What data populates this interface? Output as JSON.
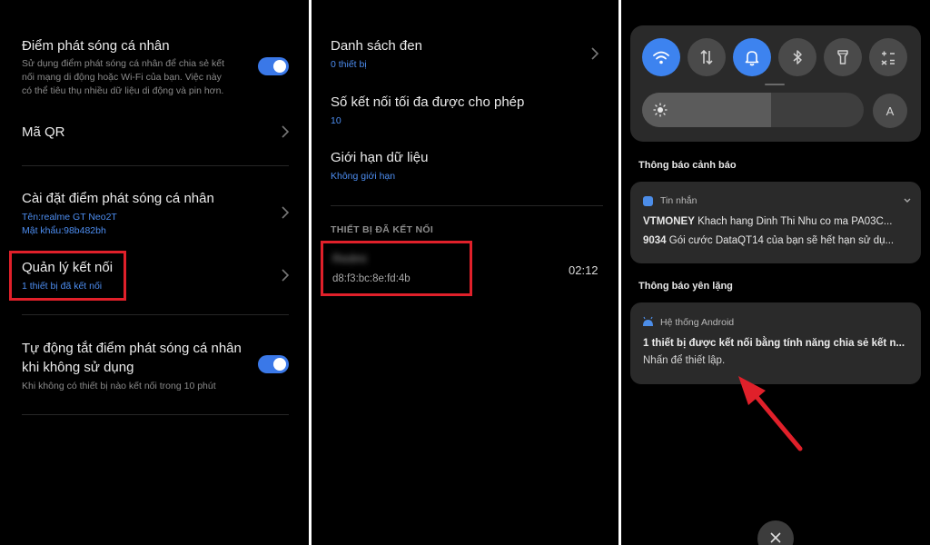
{
  "panel1": {
    "hotspot": {
      "title": "Điểm phát sóng cá nhân",
      "desc_lines": [
        "Sử dụng điểm phát sóng cá nhân để chia sẻ kết",
        "nối mạng di động hoặc Wi-Fi của bạn. Việc này",
        "có thể tiêu thụ nhiều dữ liệu di động và pin hơn."
      ],
      "toggle_on": true
    },
    "qr": {
      "title": "Mã QR"
    },
    "settings": {
      "title": "Cài đặt điểm phát sóng cá nhân",
      "name_line": "Tên:realme GT Neo2T",
      "password_line": "Mật khẩu:98b482bh"
    },
    "manage": {
      "title": "Quản lý kết nối",
      "sub": "1 thiết bị đã kết nối"
    },
    "auto_off": {
      "title_lines": [
        "Tự động tắt điểm phát sóng cá nhân",
        "khi không sử dụng"
      ],
      "desc": "Khi không có thiết bị nào kết nối trong 10 phút",
      "toggle_on": true
    }
  },
  "panel2": {
    "blacklist": {
      "title": "Danh sách đen",
      "sub": "0 thiết bị"
    },
    "max_conn": {
      "title": "Số kết nối tối đa được cho phép",
      "sub": "10"
    },
    "data_limit": {
      "title": "Giới hạn dữ liệu",
      "sub": "Không giới hạn"
    },
    "section_header": "THIẾT BỊ ĐÃ KẾT NỐI",
    "device": {
      "name": "Redmi",
      "mac": "d8:f3:bc:8e:fd:4b",
      "time": "02:12"
    }
  },
  "panel3": {
    "quick_settings": [
      {
        "icon": "wifi-icon",
        "on": true
      },
      {
        "icon": "mobile-data-icon",
        "on": false
      },
      {
        "icon": "bell-icon",
        "on": true
      },
      {
        "icon": "bluetooth-icon",
        "on": false
      },
      {
        "icon": "flashlight-icon",
        "on": false
      },
      {
        "icon": "calculator-icon",
        "on": false
      }
    ],
    "brightness_level": 0.58,
    "auto_brightness_label": "A",
    "alert_section": "Thông báo cảnh báo",
    "msg_card": {
      "app": "Tin nhắn",
      "line1_bold": "VTMONEY",
      "line1": " Khach hang Dinh Thi Nhu co ma PA03C...",
      "line2_bold": "9034",
      "line2": " Gói cước DataQT14 của bạn sẽ hết hạn sử dụ..."
    },
    "silent_section": "Thông báo yên lặng",
    "android_card": {
      "app": "Hệ thống Android",
      "title": "1 thiết bị được kết nối bằng tính năng chia sẻ kết n...",
      "text": "Nhấn để thiết lập."
    },
    "colors": {
      "accent": "#3d83ef",
      "highlight": "#e0202a"
    }
  }
}
